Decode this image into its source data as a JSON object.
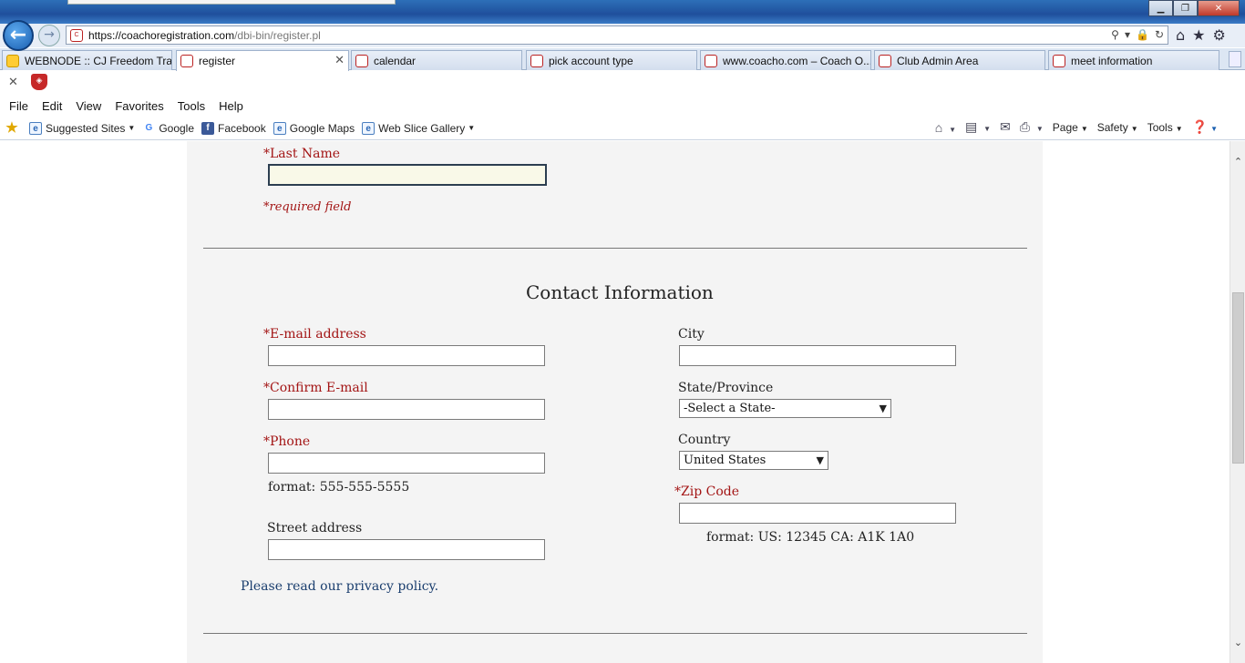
{
  "browser": {
    "url_host": "https://coachoregistration.com",
    "url_path": "/dbi-bin/register.pl",
    "tabs": [
      {
        "label": "WEBNODE :: CJ Freedom Tra..."
      },
      {
        "label": "register"
      },
      {
        "label": "calendar"
      },
      {
        "label": "pick account type"
      },
      {
        "label": "www.coacho.com – Coach O..."
      },
      {
        "label": "Club Admin Area"
      },
      {
        "label": "meet information"
      }
    ],
    "menu": [
      "File",
      "Edit",
      "View",
      "Favorites",
      "Tools",
      "Help"
    ],
    "favorites": [
      {
        "label": "Suggested Sites",
        "icon": "ie-icon"
      },
      {
        "label": "Google",
        "icon": "google-icon"
      },
      {
        "label": "Facebook",
        "icon": "facebook-icon"
      },
      {
        "label": "Google Maps",
        "icon": "ie-icon"
      },
      {
        "label": "Web Slice Gallery",
        "icon": "ie-icon"
      }
    ],
    "commands": [
      "Page",
      "Safety",
      "Tools"
    ]
  },
  "form": {
    "last_name_label": "Last Name",
    "required_note": "*required field",
    "contact_title": "Contact Information",
    "required_mark": "*",
    "email_label": "E-mail address",
    "confirm_email_label": "Confirm E-mail",
    "phone_label": "Phone",
    "phone_format": "format: 555-555-5555",
    "street_label": "Street address",
    "privacy_link": "Please read our privacy policy.",
    "city_label": "City",
    "state_label": "State/Province",
    "state_value": "-Select a State-",
    "country_label": "Country",
    "country_value": "United States",
    "zip_label": "Zip Code",
    "zip_format": "format: US: 12345 CA: A1K 1A0"
  }
}
